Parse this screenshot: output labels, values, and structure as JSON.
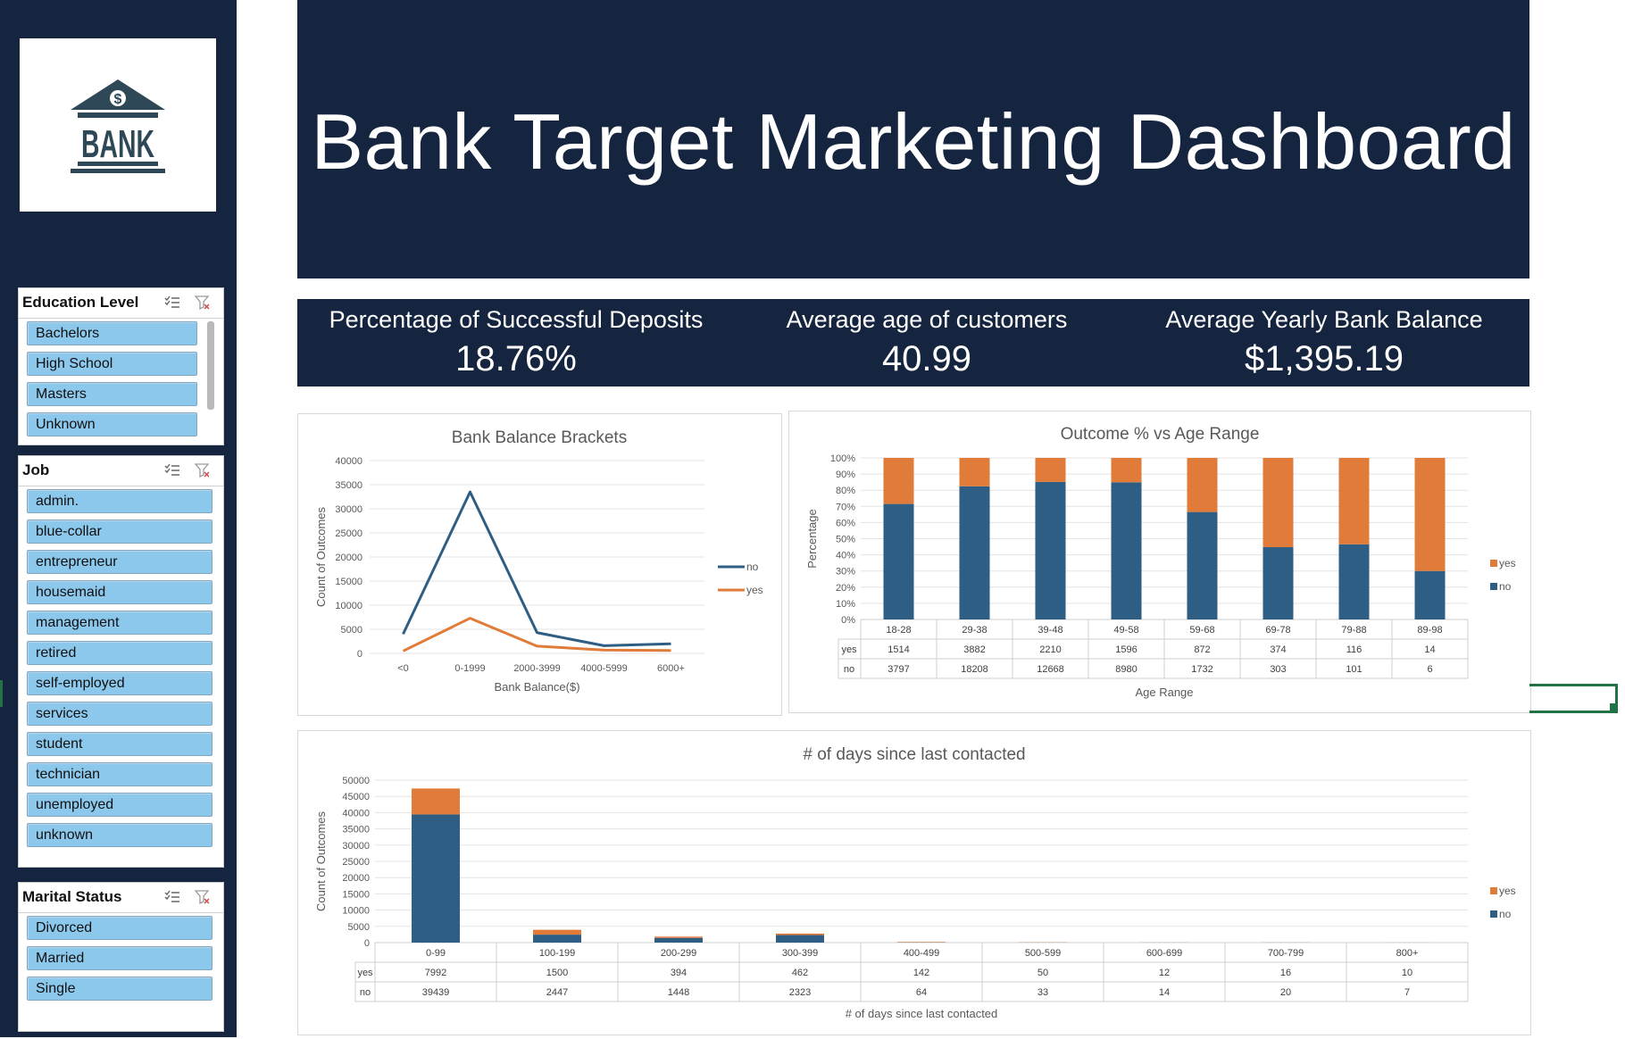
{
  "logo": {
    "text": "BANK",
    "symbol": "$"
  },
  "slicers": {
    "education": {
      "title": "Education Level",
      "items": [
        "Bachelors",
        "High School",
        "Masters",
        "Unknown"
      ]
    },
    "job": {
      "title": "Job",
      "items": [
        "admin.",
        "blue-collar",
        "entrepreneur",
        "housemaid",
        "management",
        "retired",
        "self-employed",
        "services",
        "student",
        "technician",
        "unemployed",
        "unknown"
      ]
    },
    "marital": {
      "title": "Marital Status",
      "items": [
        "Divorced",
        "Married",
        "Single"
      ]
    },
    "icons": [
      "multi-select-icon",
      "clear-filter-icon"
    ]
  },
  "header": {
    "title": "Bank Target Marketing Dashboard"
  },
  "kpis": [
    {
      "label": "Percentage of Successful Deposits",
      "value": "18.76%"
    },
    {
      "label": "Average age of customers",
      "value": "40.99"
    },
    {
      "label": "Average Yearly Bank Balance",
      "value": "$1,395.19"
    }
  ],
  "colors": {
    "no": "#2e5e83",
    "yes": "#e07b3a",
    "navy": "#15253f",
    "slicer": "#8cc7ec"
  },
  "chart_data": [
    {
      "type": "line",
      "title": "Bank Balance Brackets",
      "xlabel": "Bank Balance($)",
      "ylabel": "Count of Outcomes",
      "categories": [
        "<0",
        "0-1999",
        "2000-3999",
        "4000-5999",
        "6000+"
      ],
      "yticks": [
        "0",
        "5000",
        "10000",
        "15000",
        "20000",
        "25000",
        "30000",
        "35000",
        "40000"
      ],
      "ylim": [
        0,
        40000
      ],
      "legend_position": "right",
      "series": [
        {
          "name": "no",
          "values": [
            4000,
            33500,
            4300,
            1600,
            2000
          ]
        },
        {
          "name": "yes",
          "values": [
            500,
            7300,
            1500,
            700,
            600
          ]
        }
      ]
    },
    {
      "type": "bar",
      "stacked_percent": true,
      "title": "Outcome % vs Age Range",
      "xlabel": "Age Range",
      "ylabel": "Percentage",
      "categories": [
        "18-28",
        "29-38",
        "39-48",
        "49-58",
        "59-68",
        "69-78",
        "79-88",
        "89-98"
      ],
      "yticks": [
        "0%",
        "10%",
        "20%",
        "30%",
        "40%",
        "50%",
        "60%",
        "70%",
        "80%",
        "90%",
        "100%"
      ],
      "legend_position": "right",
      "series": [
        {
          "name": "yes",
          "values": [
            1514,
            3882,
            2210,
            1596,
            872,
            374,
            116,
            14
          ]
        },
        {
          "name": "no",
          "values": [
            3797,
            18208,
            12668,
            8980,
            1732,
            303,
            101,
            6
          ]
        }
      ]
    },
    {
      "type": "bar",
      "stacked": true,
      "title": "# of days since last contacted",
      "xlabel": "# of days since last contacted",
      "ylabel": "Count of Outcomes",
      "categories": [
        "0-99",
        "100-199",
        "200-299",
        "300-399",
        "400-499",
        "500-599",
        "600-699",
        "700-799",
        "800+"
      ],
      "yticks": [
        "0",
        "5000",
        "10000",
        "15000",
        "20000",
        "25000",
        "30000",
        "35000",
        "40000",
        "45000",
        "50000"
      ],
      "ylim": [
        0,
        50000
      ],
      "legend_position": "right",
      "series": [
        {
          "name": "yes",
          "values": [
            7992,
            1500,
            394,
            462,
            142,
            50,
            12,
            16,
            10
          ]
        },
        {
          "name": "no",
          "values": [
            39439,
            2447,
            1448,
            2323,
            64,
            33,
            14,
            20,
            7
          ]
        }
      ]
    }
  ]
}
